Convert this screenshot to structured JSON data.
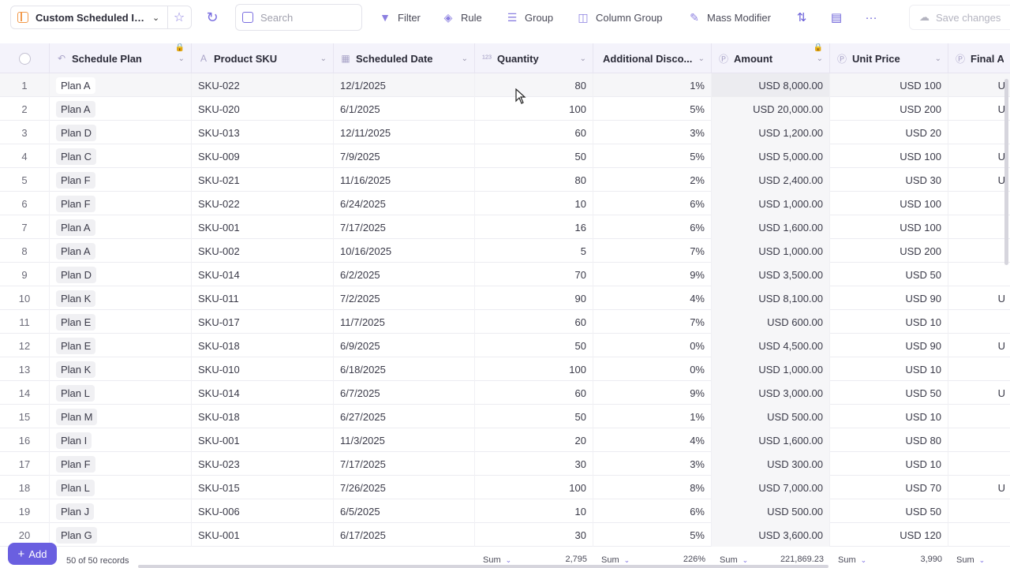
{
  "toolbar": {
    "view_name": "Custom Scheduled Ite...",
    "search_placeholder": "Search",
    "filter_label": "Filter",
    "rule_label": "Rule",
    "group_label": "Group",
    "column_group_label": "Column Group",
    "mass_modifier_label": "Mass Modifier",
    "save_label": "Save changes"
  },
  "columns": {
    "schedule_plan": "Schedule Plan",
    "product_sku": "Product SKU",
    "scheduled_date": "Scheduled Date",
    "quantity": "Quantity",
    "additional_discount": "Additional Disco...",
    "amount": "Amount",
    "unit_price": "Unit Price",
    "final_amount": "Final Am"
  },
  "rows": [
    {
      "idx": "1",
      "plan": "Plan A",
      "sku": "SKU-022",
      "date": "12/1/2025",
      "qty": "80",
      "disc": "1%",
      "amount": "USD 8,000.00",
      "unit": "USD 100",
      "final_edge": "U"
    },
    {
      "idx": "2",
      "plan": "Plan A",
      "sku": "SKU-020",
      "date": "6/1/2025",
      "qty": "100",
      "disc": "5%",
      "amount": "USD 20,000.00",
      "unit": "USD 200",
      "final_edge": "U"
    },
    {
      "idx": "3",
      "plan": "Plan D",
      "sku": "SKU-013",
      "date": "12/11/2025",
      "qty": "60",
      "disc": "3%",
      "amount": "USD 1,200.00",
      "unit": "USD 20",
      "final_edge": ""
    },
    {
      "idx": "4",
      "plan": "Plan C",
      "sku": "SKU-009",
      "date": "7/9/2025",
      "qty": "50",
      "disc": "5%",
      "amount": "USD 5,000.00",
      "unit": "USD 100",
      "final_edge": "U"
    },
    {
      "idx": "5",
      "plan": "Plan F",
      "sku": "SKU-021",
      "date": "11/16/2025",
      "qty": "80",
      "disc": "2%",
      "amount": "USD 2,400.00",
      "unit": "USD 30",
      "final_edge": "U"
    },
    {
      "idx": "6",
      "plan": "Plan F",
      "sku": "SKU-022",
      "date": "6/24/2025",
      "qty": "10",
      "disc": "6%",
      "amount": "USD 1,000.00",
      "unit": "USD 100",
      "final_edge": ""
    },
    {
      "idx": "7",
      "plan": "Plan A",
      "sku": "SKU-001",
      "date": "7/17/2025",
      "qty": "16",
      "disc": "6%",
      "amount": "USD 1,600.00",
      "unit": "USD 100",
      "final_edge": ""
    },
    {
      "idx": "8",
      "plan": "Plan A",
      "sku": "SKU-002",
      "date": "10/16/2025",
      "qty": "5",
      "disc": "7%",
      "amount": "USD 1,000.00",
      "unit": "USD 200",
      "final_edge": ""
    },
    {
      "idx": "9",
      "plan": "Plan D",
      "sku": "SKU-014",
      "date": "6/2/2025",
      "qty": "70",
      "disc": "9%",
      "amount": "USD 3,500.00",
      "unit": "USD 50",
      "final_edge": ""
    },
    {
      "idx": "10",
      "plan": "Plan K",
      "sku": "SKU-011",
      "date": "7/2/2025",
      "qty": "90",
      "disc": "4%",
      "amount": "USD 8,100.00",
      "unit": "USD 90",
      "final_edge": "U"
    },
    {
      "idx": "11",
      "plan": "Plan E",
      "sku": "SKU-017",
      "date": "11/7/2025",
      "qty": "60",
      "disc": "7%",
      "amount": "USD 600.00",
      "unit": "USD 10",
      "final_edge": ""
    },
    {
      "idx": "12",
      "plan": "Plan E",
      "sku": "SKU-018",
      "date": "6/9/2025",
      "qty": "50",
      "disc": "0%",
      "amount": "USD 4,500.00",
      "unit": "USD 90",
      "final_edge": "U"
    },
    {
      "idx": "13",
      "plan": "Plan K",
      "sku": "SKU-010",
      "date": "6/18/2025",
      "qty": "100",
      "disc": "0%",
      "amount": "USD 1,000.00",
      "unit": "USD 10",
      "final_edge": ""
    },
    {
      "idx": "14",
      "plan": "Plan L",
      "sku": "SKU-014",
      "date": "6/7/2025",
      "qty": "60",
      "disc": "9%",
      "amount": "USD 3,000.00",
      "unit": "USD 50",
      "final_edge": "U"
    },
    {
      "idx": "15",
      "plan": "Plan M",
      "sku": "SKU-018",
      "date": "6/27/2025",
      "qty": "50",
      "disc": "1%",
      "amount": "USD 500.00",
      "unit": "USD 10",
      "final_edge": ""
    },
    {
      "idx": "16",
      "plan": "Plan I",
      "sku": "SKU-001",
      "date": "11/3/2025",
      "qty": "20",
      "disc": "4%",
      "amount": "USD 1,600.00",
      "unit": "USD 80",
      "final_edge": ""
    },
    {
      "idx": "17",
      "plan": "Plan F",
      "sku": "SKU-023",
      "date": "7/17/2025",
      "qty": "30",
      "disc": "3%",
      "amount": "USD 300.00",
      "unit": "USD 10",
      "final_edge": ""
    },
    {
      "idx": "18",
      "plan": "Plan L",
      "sku": "SKU-015",
      "date": "7/26/2025",
      "qty": "100",
      "disc": "8%",
      "amount": "USD 7,000.00",
      "unit": "USD 70",
      "final_edge": "U"
    },
    {
      "idx": "19",
      "plan": "Plan J",
      "sku": "SKU-006",
      "date": "6/5/2025",
      "qty": "10",
      "disc": "6%",
      "amount": "USD 500.00",
      "unit": "USD 50",
      "final_edge": ""
    },
    {
      "idx": "20",
      "plan": "Plan G",
      "sku": "SKU-001",
      "date": "6/17/2025",
      "qty": "30",
      "disc": "5%",
      "amount": "USD 3,600.00",
      "unit": "USD 120",
      "final_edge": ""
    }
  ],
  "footer": {
    "add_label": "Add",
    "records_text": "50 of 50 records",
    "sum_label": "Sum",
    "sum_quantity": "2,795",
    "sum_discount": "226%",
    "sum_amount": "221,869.23",
    "sum_unit_price": "3,990"
  },
  "colors": {
    "accent": "#6a5fe0",
    "header_bg": "#f4f3fb",
    "table_icon": "#f2994a"
  }
}
